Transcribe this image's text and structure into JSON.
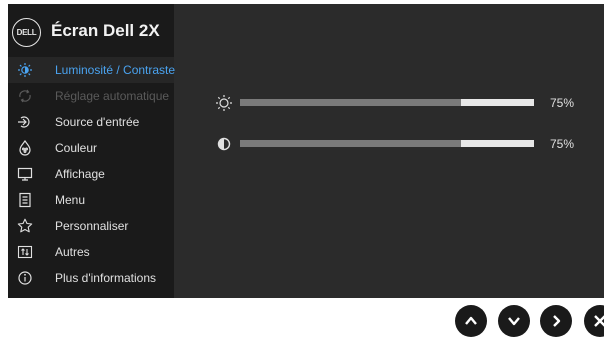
{
  "header": {
    "logo_text": "DELL",
    "title": "Écran Dell 2X"
  },
  "menu": [
    {
      "label": "Luminosité / Contraste",
      "icon": "brightness-icon",
      "state": "active"
    },
    {
      "label": "Réglage automatique",
      "icon": "auto-adjust-icon",
      "state": "disabled"
    },
    {
      "label": "Source d'entrée",
      "icon": "input-source-icon",
      "state": "normal"
    },
    {
      "label": "Couleur",
      "icon": "color-icon",
      "state": "normal"
    },
    {
      "label": "Affichage",
      "icon": "display-icon",
      "state": "normal"
    },
    {
      "label": "Menu",
      "icon": "menu-icon",
      "state": "normal"
    },
    {
      "label": "Personnaliser",
      "icon": "star-icon",
      "state": "normal"
    },
    {
      "label": "Autres",
      "icon": "others-icon",
      "state": "normal"
    },
    {
      "label": "Plus d'informations",
      "icon": "info-icon",
      "state": "normal"
    }
  ],
  "sliders": {
    "brightness": {
      "icon": "brightness-icon",
      "value": 75,
      "value_label": "75%"
    },
    "contrast": {
      "icon": "contrast-icon",
      "value": 75,
      "value_label": "75%"
    }
  },
  "buttons": [
    "up-button",
    "down-button",
    "right-button",
    "close-button"
  ],
  "colors": {
    "accent": "#4aa3f0",
    "panel": "#2b2b2b",
    "sidebar": "#1a1a1a",
    "track": "#e8e8e8",
    "fill": "#7a7a7a"
  }
}
